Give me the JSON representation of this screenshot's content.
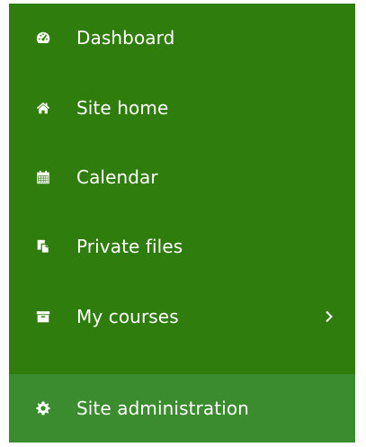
{
  "drawer": {
    "background": "#2f7d0c",
    "admin_background": "#3a8c2e",
    "items": [
      {
        "label": "Dashboard",
        "icon": "dashboard-gauge-icon"
      },
      {
        "label": "Site home",
        "icon": "home-icon"
      },
      {
        "label": "Calendar",
        "icon": "calendar-icon"
      },
      {
        "label": "Private files",
        "icon": "files-icon"
      },
      {
        "label": "My courses",
        "icon": "archive-box-icon",
        "has_submenu": true
      }
    ],
    "admin": {
      "label": "Site administration",
      "icon": "gear-icon"
    }
  }
}
